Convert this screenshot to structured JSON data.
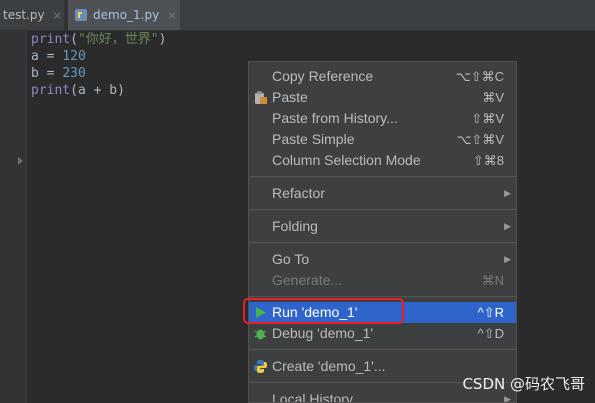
{
  "tabs": [
    {
      "label": "test.py",
      "close": "×"
    },
    {
      "label": "demo_1.py",
      "close": "×"
    }
  ],
  "code": {
    "line1_fn": "print",
    "line1_open": "(",
    "line1_str": "\"你好，世界\"",
    "line1_close": ")",
    "line2_text": "a = ",
    "line2_num": "120",
    "line3_text": "b = ",
    "line3_num": "230",
    "line4_fn": "print",
    "line4_rest": "(a + b)"
  },
  "menu": {
    "copy_reference": {
      "label": "Copy Reference",
      "shortcut": "⌥⇧⌘C"
    },
    "paste": {
      "label": "Paste",
      "shortcut": "⌘V",
      "icon": "clipboard-icon"
    },
    "paste_history": {
      "label": "Paste from History...",
      "shortcut": "⇧⌘V"
    },
    "paste_simple": {
      "label": "Paste Simple",
      "shortcut": "⌥⇧⌘V"
    },
    "column_selection": {
      "label": "Column Selection Mode",
      "shortcut": "⇧⌘8"
    },
    "refactor": {
      "label": "Refactor",
      "arrow": "▶"
    },
    "folding": {
      "label": "Folding",
      "arrow": "▶"
    },
    "go_to": {
      "label": "Go To",
      "arrow": "▶"
    },
    "generate": {
      "label": "Generate...",
      "shortcut": "⌘N",
      "disabled": true
    },
    "run": {
      "label": "Run 'demo_1'",
      "shortcut": "^⇧R",
      "icon": "play-icon"
    },
    "debug": {
      "label": "Debug 'demo_1'",
      "shortcut": "^⇧D",
      "icon": "bug-icon"
    },
    "create": {
      "label": "Create 'demo_1'...",
      "icon": "python-icon"
    },
    "local_history": {
      "label": "Local History",
      "arrow": "▶"
    }
  },
  "watermark": "CSDN @码农飞哥",
  "colors": {
    "selection": "#2f65ca",
    "highlight_box": "#e8202a",
    "run_icon": "#4caf50",
    "debug_icon": "#4caf50"
  }
}
